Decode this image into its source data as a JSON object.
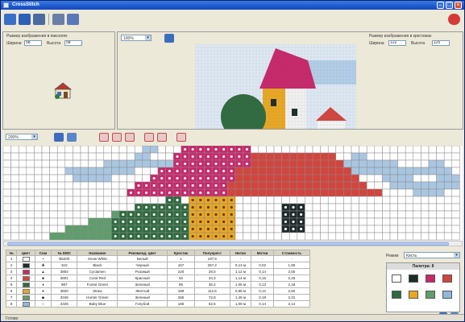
{
  "window": {
    "title": "CrossStitch"
  },
  "toolbar": {
    "buttons": [
      {
        "name": "open-file-icon",
        "color": "#3a6fc8"
      },
      {
        "name": "save-icon",
        "color": "#2e5fb8"
      },
      {
        "name": "grid-view-icon",
        "color": "#4a6aa0"
      },
      {
        "name": "tools-icon",
        "color": "#6a7fa8"
      },
      {
        "name": "settings-icon",
        "color": "#5a78b8"
      }
    ],
    "exit_icon": "exit-icon"
  },
  "source_panel": {
    "caption": "Размер изображения в пикселях",
    "width_label": "Ширина",
    "width_value": "58",
    "height_label": "Высота",
    "height_value": "58"
  },
  "preview_panel": {
    "zoom_value": "100%",
    "caption": "Размер изображения в крестиках",
    "width_label": "Ширина",
    "width_value": "122",
    "height_label": "Высота",
    "height_value": "125"
  },
  "grid_toolbar": {
    "zoom_value": "200%"
  },
  "pattern": {
    "colors": {
      "W": "#ffffff",
      "L": "#a9c6e1",
      "P": "#c8276a",
      "R": "#d1453e",
      "D": "#2f6a3f",
      "M": "#5f9e6c",
      "Y": "#e9a823",
      "K": "#1d2a2a",
      "B": "#90b8dc",
      "G": "#c9d6ee"
    },
    "rows": [
      "WWWWWWWWWWWWWWWWWWLLWWWPPPPPPPPPWWWWWWWWWWWWWWWWWWWWWWWWWWW",
      "WWWWWWWWWWWWWWWWWLLWWWPPPPPPPPPPRRRRRRRRRRRWWLLWWWWWWWWWWWWW",
      "WWWWWWWWWWWWWLLLLLLLLLPPPPPPPPPPRRRRRRRRRRRRLLLLLLLWWWWLLWWWW",
      "WWWWWWWWLLLLLLLLLWWWPPPPPPPPPPRRRRRRRRRRRRRRRLLLLLLLLLLLLLWWWW",
      "WWWWWWWWWLLLLLWWWWWPPPPPPPPPPPRRRRRRRRRRRRRRRRWWWLLLLWWWLLLLWW",
      "WWWWWWWWWWWWWWWWWPPPPPPPPPPPPRRRRRRRRRRRRRRRRRRWWWLLLLLLLLLLLL",
      "WWWWWWWWWWWWWWWWPPPPPPPPPPPPPRRRRRRRRRRRRRRRRRRRRWWWWLLLLWWWWW",
      "WWWWWWWWWWWWWWWWWWWWWDDWYYYYYYWWWWWWWWWWWWWWWWWWWWWWWWWWWWWWWW",
      "WWWWWWWWWWWWWWWWWDDDDDDDYYYYYYWWWWWWKKKWWWWWWWWWWWWWWWWWWWWWW",
      "WWWWWWWWWWWWWWMDDDDDDDDDYYYYYYWWWWWWKKKWWWWWWWWWWWWWWWWWWWWWW",
      "WWWWWWWWWWWMMMDDDDDDDDDDYYYYYYWWWWWWKKKWWWWWWWWWWWWWWWWWWWWWW",
      "WWWWWWWWMMMMMMDDDDDDDDDDYYYYYYWWWWWWKKKWWWWWWWWWWWWWWWWWWWWWW",
      "WWWWWWMMMMMMMMDDDDDDDDDDYYYYYYWWWWWWWWWWWWWWWWWWWWWWWWWWWWWWW"
    ]
  },
  "thread_table": {
    "headers": [
      "№",
      "Цвет",
      "Сим",
      "№ DMC",
      "Название",
      "Рекоменд. цвет",
      "Крестик",
      "Полукрест",
      "Нитки",
      "Мотки",
      "Стоимость"
    ],
    "rows": [
      {
        "n": "1",
        "color": "#ffffff",
        "sym": "•",
        "dmc": "B5200",
        "name": "Snow White",
        "rec": "Белый",
        "cross": "1",
        "half": "197,5",
        "thread": "-",
        "skein": "-",
        "cost": "-"
      },
      {
        "n": "2",
        "color": "#1d2a2a",
        "sym": "✚",
        "dmc": "310",
        "name": "Black",
        "rec": "Черный",
        "cross": "157",
        "half": "257,2",
        "thread": "0,13 м",
        "skein": "0,02",
        "cost": "1,90"
      },
      {
        "n": "3",
        "color": "#c8276a",
        "sym": "▲",
        "dmc": "3804",
        "name": "Cyclamen",
        "rec": "Розовый",
        "cross": "220",
        "half": "28,5",
        "thread": "1,12 м",
        "skein": "0,14",
        "cost": "2,05"
      },
      {
        "n": "4",
        "color": "#d1453e",
        "sym": "■",
        "dmc": "3801",
        "name": "Coral Red",
        "rec": "Красный",
        "cross": "92",
        "half": "34,4",
        "thread": "1,14 м",
        "skein": "0,15",
        "cost": "2,45"
      },
      {
        "n": "5",
        "color": "#2f6a3f",
        "sym": "♦",
        "dmc": "987",
        "name": "Forest Green",
        "rec": "Зеленый",
        "cross": "95",
        "half": "36,4",
        "thread": "1,05 м",
        "skein": "0,13",
        "cost": "2,18"
      },
      {
        "n": "6",
        "color": "#e9a823",
        "sym": "●",
        "dmc": "3820",
        "name": "Straw",
        "rec": "Желтый",
        "cross": "189",
        "half": "112,5",
        "thread": "0,98 м",
        "skein": "0,12",
        "cost": "2,60"
      },
      {
        "n": "7",
        "color": "#5f9e6c",
        "sym": "◆",
        "dmc": "3346",
        "name": "Hunter Green",
        "rec": "Зеленый",
        "cross": "265",
        "half": "72,8",
        "thread": "1,46 м",
        "skein": "0,18",
        "cost": "2,31"
      },
      {
        "n": "8",
        "color": "#90b8dc",
        "sym": "○",
        "dmc": "3325",
        "name": "Baby Blue",
        "rec": "Голубой",
        "cross": "185",
        "half": "52,5",
        "thread": "1,09 м",
        "skein": "0,14",
        "cost": "2,14"
      }
    ]
  },
  "right_panel": {
    "mode_label": "Режим",
    "mode_value": "Кисть",
    "palette_title": "Палитра: 8",
    "swatches": [
      "#ffffff",
      "#1d2a2a",
      "#c8276a",
      "#d1453e",
      "#2f6a3f",
      "#e9a823",
      "#5f9e6c",
      "#90b8dc"
    ]
  },
  "status": {
    "text": "Готово"
  }
}
